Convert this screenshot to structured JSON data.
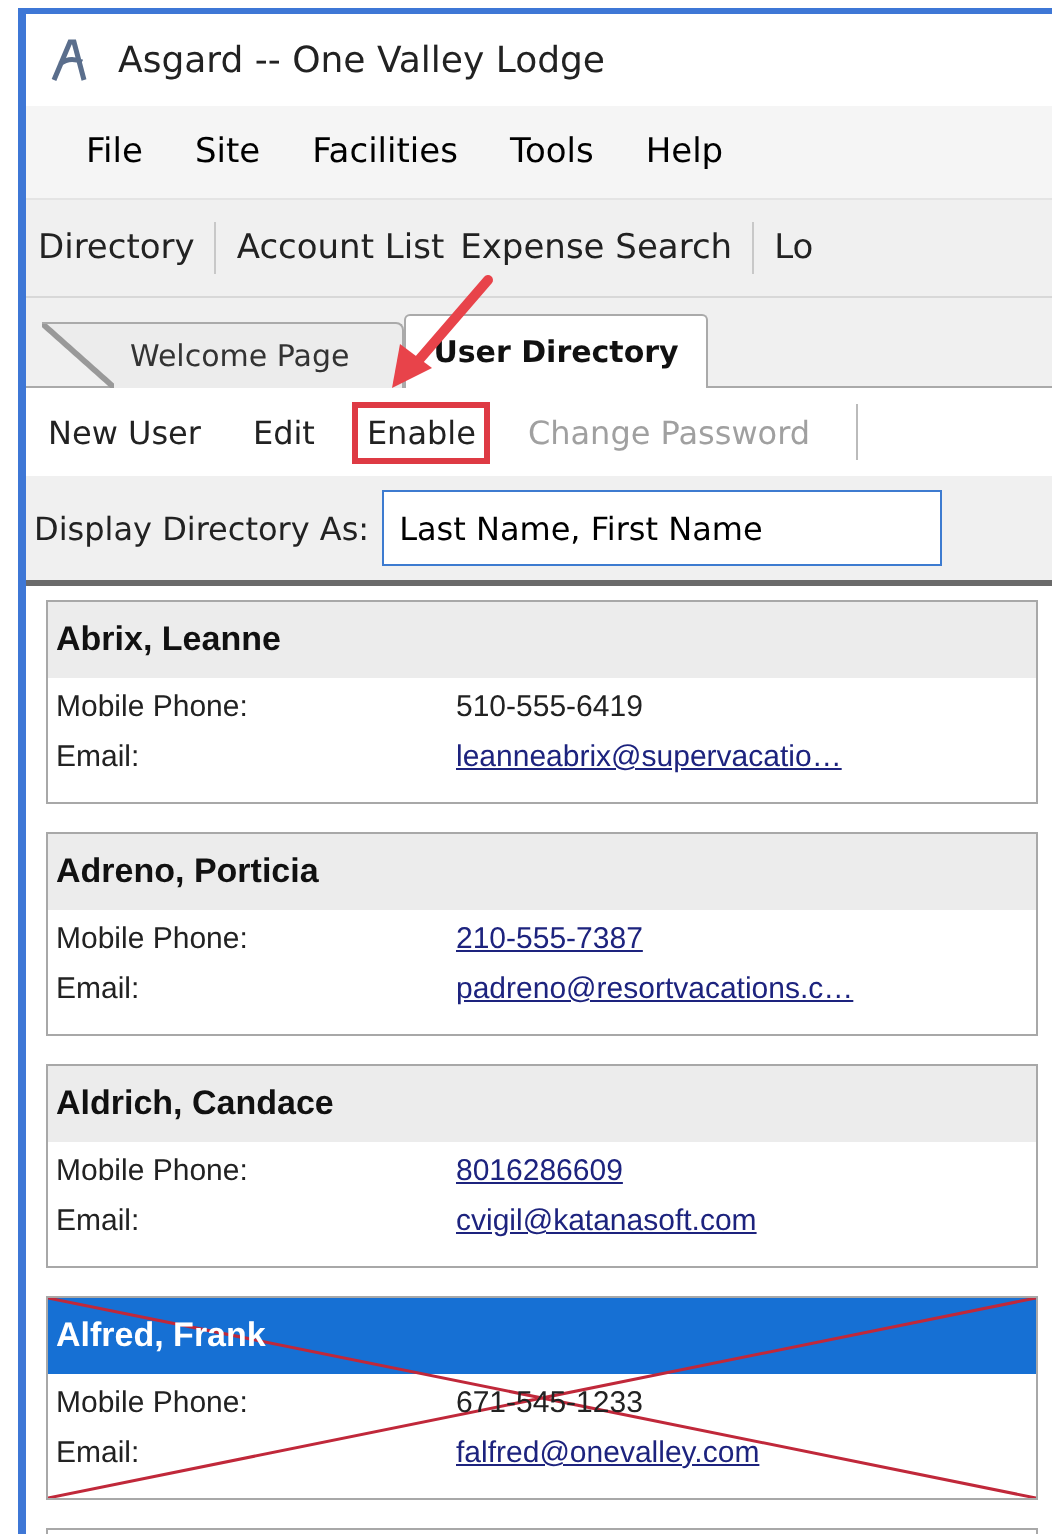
{
  "window": {
    "title": "Asgard -- One Valley Lodge"
  },
  "menu": [
    "File",
    "Site",
    "Facilities",
    "Tools",
    "Help"
  ],
  "nav_toolbar": [
    "Directory",
    "Account List",
    "Expense Search",
    "Lo"
  ],
  "tabs": [
    {
      "label": "Welcome Page",
      "selected": false
    },
    {
      "label": "User Directory",
      "selected": true
    }
  ],
  "actions": [
    {
      "label": "New User",
      "disabled": false,
      "highlighted": false
    },
    {
      "label": "Edit",
      "disabled": false,
      "highlighted": false
    },
    {
      "label": "Enable",
      "disabled": false,
      "highlighted": true
    },
    {
      "label": "Change Password",
      "disabled": true,
      "highlighted": false
    }
  ],
  "display": {
    "label": "Display Directory As:",
    "value": "Last Name, First Name"
  },
  "users": [
    {
      "name": "Abrix, Leanne",
      "phone_label": "Mobile Phone:",
      "phone": "510-555-6419",
      "phone_link": false,
      "email_label": "Email:",
      "email": "leanneabrix@supervacatio…",
      "selected": false,
      "disabled": false
    },
    {
      "name": "Adreno, Porticia",
      "phone_label": "Mobile Phone:",
      "phone": "210-555-7387",
      "phone_link": true,
      "email_label": "Email:",
      "email": "padreno@resortvacations.c…",
      "selected": false,
      "disabled": false
    },
    {
      "name": "Aldrich, Candace",
      "phone_label": "Mobile Phone:",
      "phone": "8016286609",
      "phone_link": true,
      "email_label": "Email:",
      "email": "cvigil@katanasoft.com",
      "selected": false,
      "disabled": false
    },
    {
      "name": "Alfred, Frank",
      "phone_label": "Mobile Phone:",
      "phone": "671-545-1233",
      "phone_link": false,
      "email_label": "Email:",
      "email": "falfred@onevalley.com",
      "selected": true,
      "disabled": true
    }
  ]
}
